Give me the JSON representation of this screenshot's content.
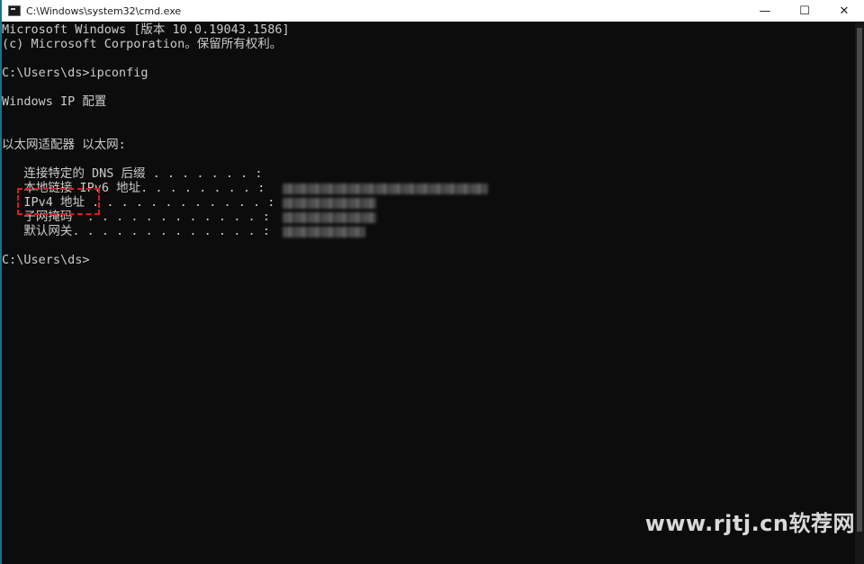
{
  "window": {
    "title": "C:\\Windows\\system32\\cmd.exe",
    "controls": {
      "minimize": "—",
      "maximize": "☐",
      "close": "✕"
    }
  },
  "console": {
    "lines": [
      "Microsoft Windows [版本 10.0.19043.1586]",
      "(c) Microsoft Corporation。保留所有权利。",
      "",
      "C:\\Users\\ds>ipconfig",
      "",
      "Windows IP 配置",
      "",
      "",
      "以太网适配器 以太网:",
      "",
      "   连接特定的 DNS 后缀 . . . . . . . :",
      "   本地链接 IPv6 地址. . . . . . . . :",
      "   IPv4 地址 . . . . . . . . . . . . :",
      "   子网掩码  . . . . . . . . . . . . :",
      "   默认网关. . . . . . . . . . . . . :",
      "",
      "C:\\Users\\ds>"
    ]
  },
  "annotation": {
    "highlighted_field": "IPv4 地址",
    "color": "#e01a1a"
  },
  "watermark": {
    "text": "www.rjtj.cn软荐网"
  },
  "colors": {
    "console_bg": "#0c0c0c",
    "console_text": "#cccccc",
    "titlebar_bg": "#ffffff"
  }
}
